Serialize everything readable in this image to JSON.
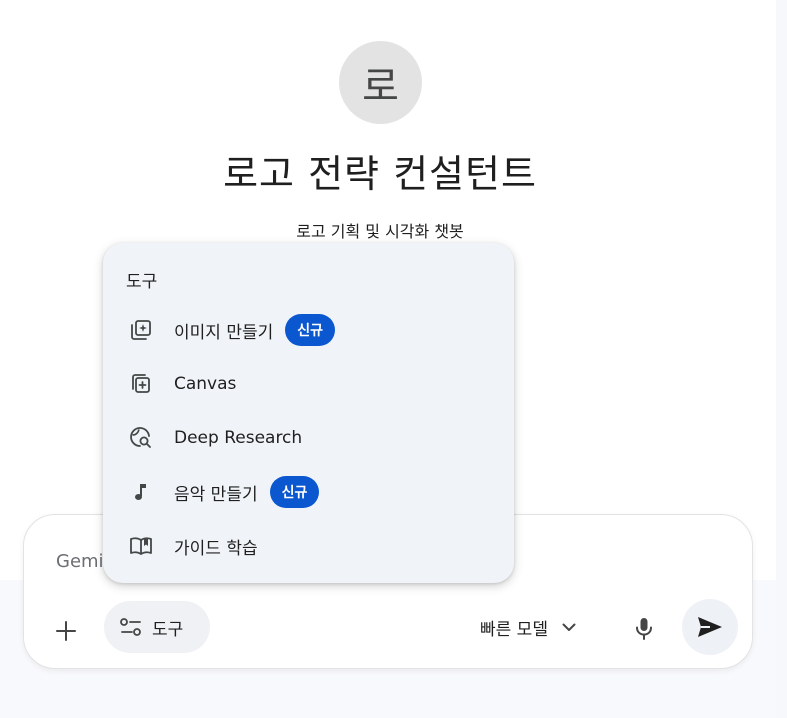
{
  "gem": {
    "avatar_letter": "로",
    "title": "로고 전략 컨설턴트",
    "description": "로고 기획 및 시각화 챗봇"
  },
  "composer": {
    "placeholder": "Gemini에게 물어보기",
    "tools_label": "도구",
    "model_label": "빠른 모델"
  },
  "tools_menu": {
    "heading": "도구",
    "items": [
      {
        "label": "이미지 만들기",
        "badge": "신규",
        "icon": "image-create-icon"
      },
      {
        "label": "Canvas",
        "badge": "",
        "icon": "canvas-icon"
      },
      {
        "label": "Deep Research",
        "badge": "",
        "icon": "deep-research-icon"
      },
      {
        "label": "음악 만들기",
        "badge": "신규",
        "icon": "music-note-icon"
      },
      {
        "label": "가이드 학습",
        "badge": "",
        "icon": "open-book-icon"
      }
    ]
  },
  "colors": {
    "badge": "#0b57d0",
    "menu_bg": "#f0f3f8",
    "avatar_bg": "#e3e3e3"
  }
}
